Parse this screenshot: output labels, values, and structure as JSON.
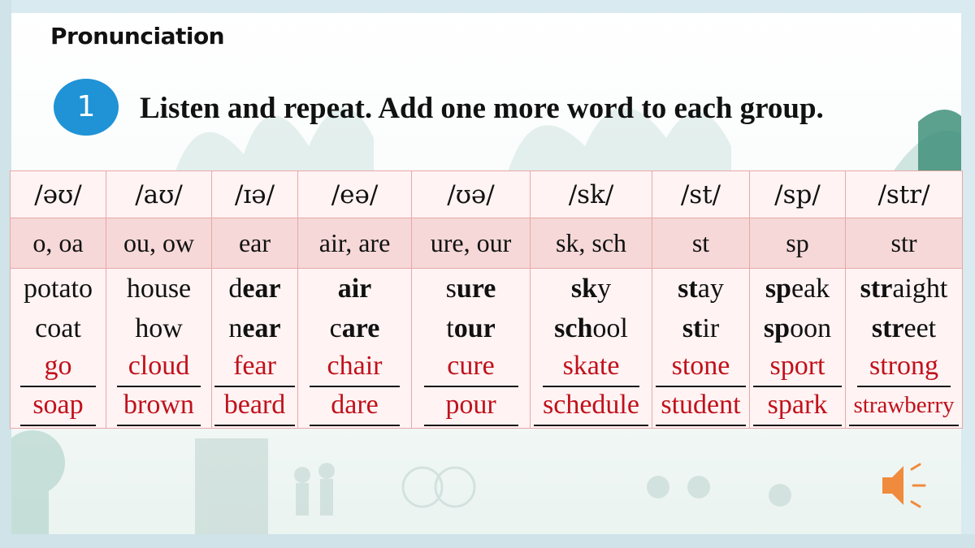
{
  "slide": {
    "section_title": "Pronunciation",
    "step_number": "1",
    "instruction": "Listen and repeat. Add one more word to each group."
  },
  "colors": {
    "badge": "#1f93d6",
    "answer_text": "#c0111b",
    "table_border": "#e7a8a8",
    "spelling_row": "#f6d8d8",
    "speaker": "#f08a3c"
  },
  "table": {
    "columns": [
      {
        "symbol": "/əʊ/",
        "spelling": "o, oa",
        "examples": [
          {
            "bold": "",
            "rest": "potato",
            "bold_pos": "none"
          },
          {
            "bold": "",
            "rest": "coat",
            "bold_pos": "none"
          }
        ],
        "answers": [
          "go",
          "soap"
        ]
      },
      {
        "symbol": "/aʊ/",
        "spelling": "ou, ow",
        "examples": [
          {
            "bold": "",
            "rest": "house",
            "bold_pos": "none"
          },
          {
            "bold": "",
            "rest": "how",
            "bold_pos": "none"
          }
        ],
        "answers": [
          "cloud",
          "brown"
        ]
      },
      {
        "symbol": "/ɪə/",
        "spelling": "ear",
        "examples": [
          {
            "pre": "d",
            "bold": "ear",
            "post": ""
          },
          {
            "pre": "n",
            "bold": "ear",
            "post": ""
          }
        ],
        "answers": [
          "fear",
          "beard"
        ]
      },
      {
        "symbol": "/eə/",
        "spelling": "air, are",
        "examples": [
          {
            "pre": "",
            "bold": "air",
            "post": ""
          },
          {
            "pre": "c",
            "bold": "are",
            "post": ""
          }
        ],
        "answers": [
          "chair",
          "dare"
        ]
      },
      {
        "symbol": "/ʊə/",
        "spelling": "ure, our",
        "examples": [
          {
            "pre": "s",
            "bold": "ure",
            "post": ""
          },
          {
            "pre": "t",
            "bold": "our",
            "post": ""
          }
        ],
        "answers": [
          "cure",
          "pour"
        ]
      },
      {
        "symbol": "/sk/",
        "spelling": "sk, sch",
        "examples": [
          {
            "pre": "",
            "bold": "sk",
            "post": "y"
          },
          {
            "pre": "",
            "bold": "sch",
            "post": "ool"
          }
        ],
        "answers": [
          "skate",
          "schedule"
        ]
      },
      {
        "symbol": "/st/",
        "spelling": "st",
        "examples": [
          {
            "pre": "",
            "bold": "st",
            "post": "ay"
          },
          {
            "pre": "",
            "bold": "st",
            "post": "ir"
          }
        ],
        "answers": [
          "stone",
          "student"
        ]
      },
      {
        "symbol": "/sp/",
        "spelling": "sp",
        "examples": [
          {
            "pre": "",
            "bold": "sp",
            "post": "eak"
          },
          {
            "pre": "",
            "bold": "sp",
            "post": "oon"
          }
        ],
        "answers": [
          "sport",
          "spark"
        ]
      },
      {
        "symbol": "/str/",
        "spelling": "str",
        "examples": [
          {
            "pre": "",
            "bold": "str",
            "post": "aight"
          },
          {
            "pre": "",
            "bold": "str",
            "post": "eet"
          }
        ],
        "answers": [
          "strong",
          "strawberry"
        ]
      }
    ]
  },
  "controls": {
    "speaker_icon": "speaker-icon"
  }
}
